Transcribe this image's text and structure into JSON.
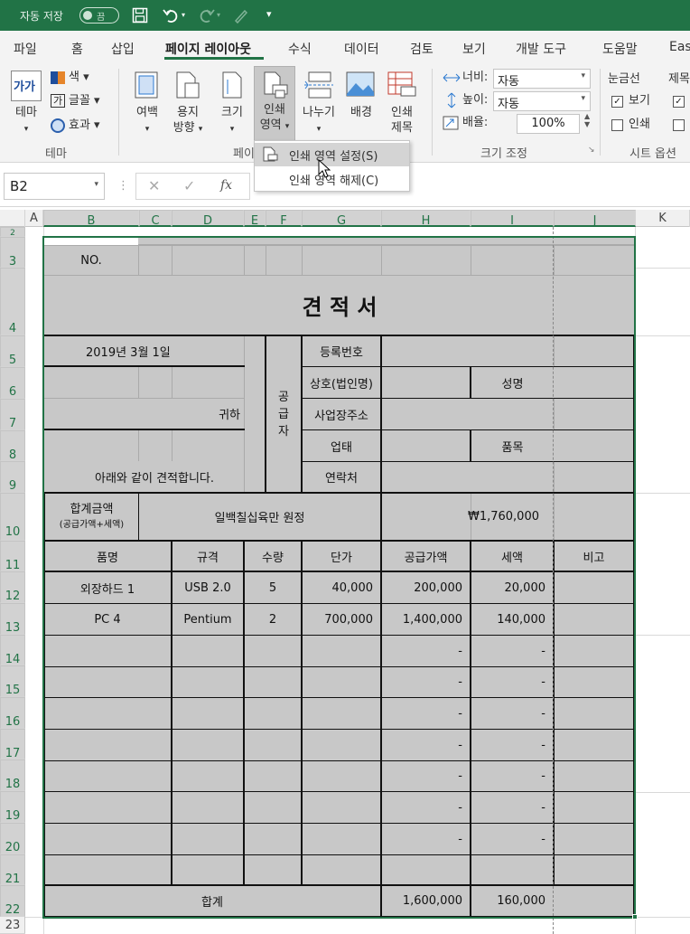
{
  "titlebar": {
    "autosave_label": "자동 저장",
    "autosave_state": "끔"
  },
  "tabs": [
    "파일",
    "홈",
    "삽입",
    "페이지 레이아웃",
    "수식",
    "데이터",
    "검토",
    "보기",
    "개발 도구",
    "도움말",
    "Eas"
  ],
  "ribbon": {
    "theme": {
      "label_line1": "테마",
      "small": [
        "색",
        "글꼴",
        "효과"
      ],
      "group": "테마",
      "icon_text": "가가"
    },
    "buttons": [
      {
        "l1": "여백",
        "l2": ""
      },
      {
        "l1": "용지",
        "l2": "방향"
      },
      {
        "l1": "크기",
        "l2": ""
      },
      {
        "l1": "인쇄",
        "l2": "영역"
      },
      {
        "l1": "나누기",
        "l2": ""
      },
      {
        "l1": "배경",
        "l2": ""
      },
      {
        "l1": "인쇄",
        "l2": "제목"
      }
    ],
    "page_setup_group": "페이",
    "scale": {
      "width_label": "너비:",
      "width_value": "자동",
      "height_label": "높이:",
      "height_value": "자동",
      "scale_label": "배율:",
      "scale_value": "100%",
      "group": "크기 조정"
    },
    "sheet_options": {
      "gridlines": "눈금선",
      "view": "보기",
      "print": "인쇄",
      "headings": "제목",
      "group": "시트 옵션",
      "gridlines_view": true,
      "gridlines_print": false
    }
  },
  "menu": {
    "items": [
      "인쇄 영역 설정(S)",
      "인쇄 영역 해제(C)"
    ]
  },
  "formula": {
    "namebox": "B2",
    "fx": "fx"
  },
  "columns": [
    "A",
    "B",
    "C",
    "D",
    "E",
    "F",
    "G",
    "H",
    "I",
    "J",
    "K"
  ],
  "rows": [
    "2",
    "3",
    "4",
    "5",
    "6",
    "7",
    "8",
    "9",
    "10",
    "11",
    "12",
    "13",
    "14",
    "15",
    "16",
    "17",
    "18",
    "19",
    "20",
    "21",
    "22",
    "23"
  ],
  "doc": {
    "no": "NO.",
    "title": "견 적 서",
    "date": "2019년    3월     1일",
    "to": "귀하",
    "intro": "아래와 같이 견적합니다.",
    "supplier": [
      "공",
      "급",
      "자"
    ],
    "reg": "등록번호",
    "company": "상호(법인명)",
    "name": "성명",
    "address": "사업장주소",
    "biz": "업태",
    "item_type": "품목",
    "contact": "연락처",
    "total_label": "합계금액",
    "total_sub": "(공급가액+세액)",
    "total_words": "일백칠십육만 원정",
    "total_amount": "₩1,760,000",
    "headers": [
      "품명",
      "규격",
      "수량",
      "단가",
      "공급가액",
      "세액",
      "비고"
    ],
    "items": [
      [
        "외장하드 1",
        "USB 2.0",
        "5",
        "40,000",
        "200,000",
        "20,000",
        ""
      ],
      [
        "PC 4",
        "Pentium",
        "2",
        "700,000",
        "1,400,000",
        "140,000",
        ""
      ],
      [
        "",
        "",
        "",
        "",
        "-",
        "-",
        ""
      ],
      [
        "",
        "",
        "",
        "",
        "-",
        "-",
        ""
      ],
      [
        "",
        "",
        "",
        "",
        "-",
        "-",
        ""
      ],
      [
        "",
        "",
        "",
        "",
        "-",
        "-",
        ""
      ],
      [
        "",
        "",
        "",
        "",
        "-",
        "-",
        ""
      ],
      [
        "",
        "",
        "",
        "",
        "-",
        "-",
        ""
      ],
      [
        "",
        "",
        "",
        "",
        "-",
        "-",
        ""
      ]
    ],
    "sum_label": "합계",
    "sum_supply": "1,600,000",
    "sum_tax": "160,000"
  }
}
